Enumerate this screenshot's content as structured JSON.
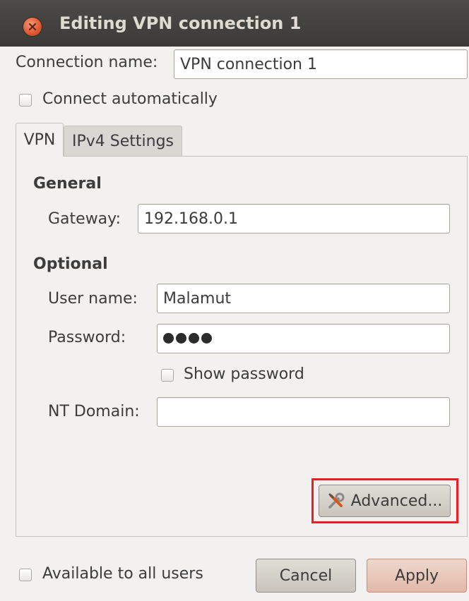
{
  "window": {
    "title": "Editing VPN connection 1"
  },
  "connection": {
    "name_label": "Connection name:",
    "name_value": "VPN connection 1",
    "auto_connect_label": "Connect automatically",
    "auto_connect_checked": false
  },
  "tabs": [
    {
      "label": "VPN",
      "active": true
    },
    {
      "label": "IPv4 Settings",
      "active": false
    }
  ],
  "general": {
    "heading": "General",
    "gateway_label": "Gateway:",
    "gateway_value": "192.168.0.1"
  },
  "optional": {
    "heading": "Optional",
    "username_label": "User name:",
    "username_value": "Malamut",
    "password_label": "Password:",
    "password_length": 4,
    "show_password_label": "Show password",
    "show_password_checked": false,
    "nt_domain_label": "NT Domain:",
    "nt_domain_value": ""
  },
  "advanced_button": {
    "label": "Advanced...",
    "icon": "wrench-screwdriver-icon",
    "highlight_color": "#ee1c24"
  },
  "footer": {
    "all_users_label": "Available to all users",
    "all_users_checked": false,
    "cancel_label": "Cancel",
    "apply_label": "Apply"
  }
}
